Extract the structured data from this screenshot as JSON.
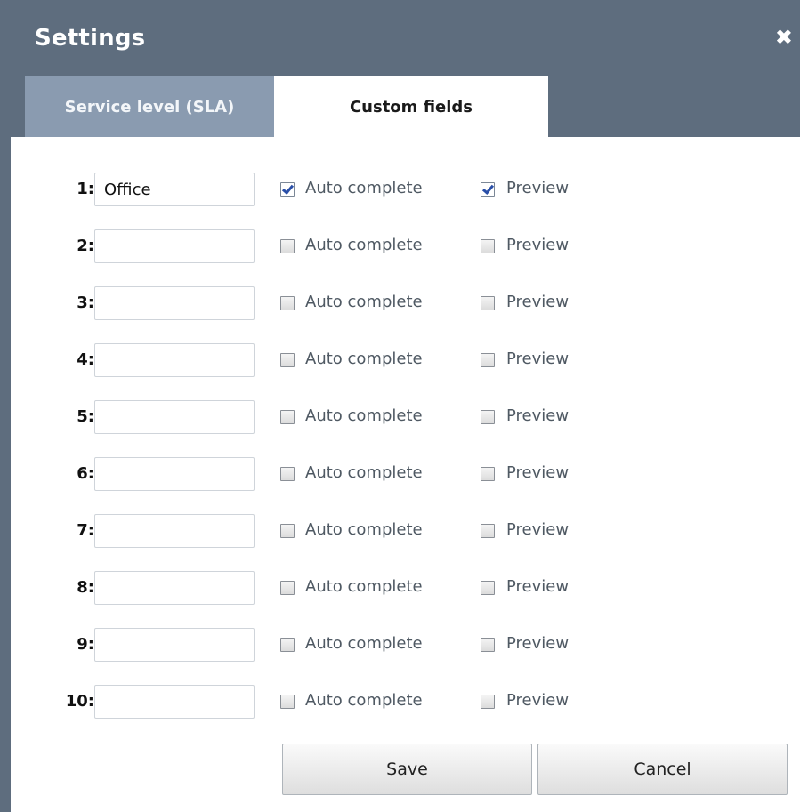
{
  "dialog": {
    "title": "Settings",
    "close_glyph": "✖"
  },
  "tabs": [
    {
      "label": "Service level (SLA)",
      "active": false
    },
    {
      "label": "Custom fields",
      "active": true
    }
  ],
  "fields": [
    {
      "number": "1:",
      "value": "Office",
      "auto_complete": true,
      "preview": true
    },
    {
      "number": "2:",
      "value": "",
      "auto_complete": false,
      "preview": false
    },
    {
      "number": "3:",
      "value": "",
      "auto_complete": false,
      "preview": false
    },
    {
      "number": "4:",
      "value": "",
      "auto_complete": false,
      "preview": false
    },
    {
      "number": "5:",
      "value": "",
      "auto_complete": false,
      "preview": false
    },
    {
      "number": "6:",
      "value": "",
      "auto_complete": false,
      "preview": false
    },
    {
      "number": "7:",
      "value": "",
      "auto_complete": false,
      "preview": false
    },
    {
      "number": "8:",
      "value": "",
      "auto_complete": false,
      "preview": false
    },
    {
      "number": "9:",
      "value": "",
      "auto_complete": false,
      "preview": false
    },
    {
      "number": "10:",
      "value": "",
      "auto_complete": false,
      "preview": false
    }
  ],
  "labels": {
    "auto_complete": "Auto complete",
    "preview": "Preview"
  },
  "buttons": {
    "save": "Save",
    "cancel": "Cancel"
  },
  "colors": {
    "header_bg": "#5e6d7e",
    "inactive_tab_bg": "#8a9bb0",
    "check_color": "#2a4fa8"
  }
}
